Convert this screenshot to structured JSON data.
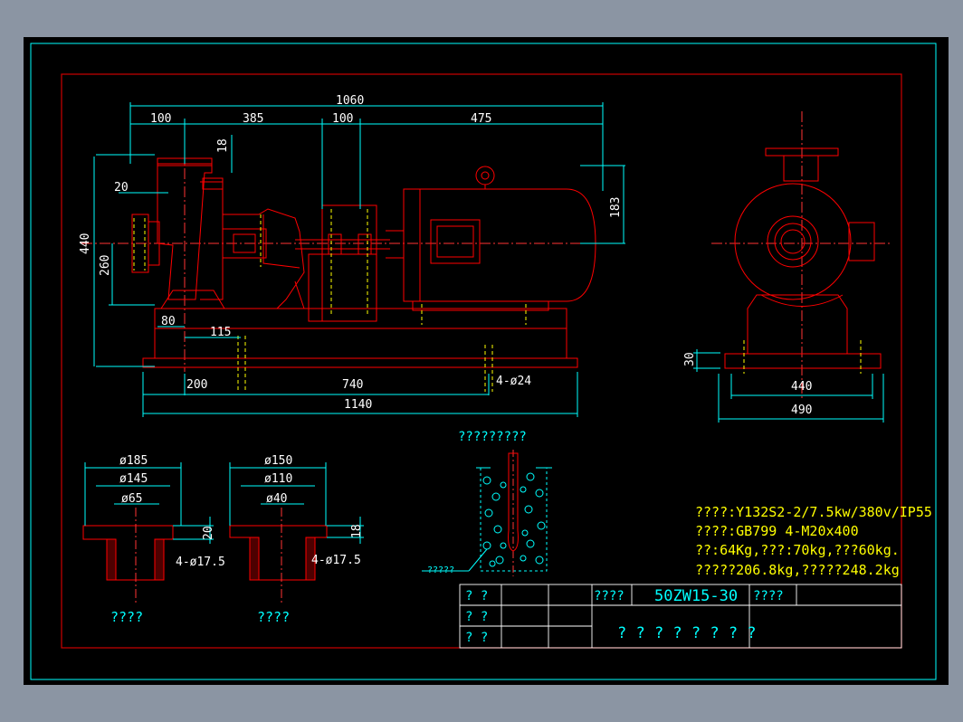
{
  "drawing": {
    "dims_front": {
      "d1060": "1060",
      "d100a": "100",
      "d385": "385",
      "d100b": "100",
      "d475": "475",
      "d18": "18",
      "d20": "20",
      "d440": "440",
      "d260": "260",
      "d183": "183",
      "d80": "80",
      "d115": "115",
      "d200": "200",
      "d740": "740",
      "d4hole": "4-ø24",
      "d1140": "1140"
    },
    "dims_side": {
      "d30": "30",
      "d440": "440",
      "d490": "490"
    },
    "flange_in": {
      "d185": "ø185",
      "d145": "ø145",
      "d65": "ø65",
      "d20": "20",
      "holes": "4-ø17.5",
      "caption": "????"
    },
    "flange_out": {
      "d150": "ø150",
      "d110": "ø110",
      "d40": "ø40",
      "d18": "18",
      "holes": "4-ø17.5",
      "caption": "????"
    },
    "anchor": {
      "title": "?????????",
      "label": "?????"
    },
    "notes": [
      "????:Y132S2-2/7.5kw/380v/IP55",
      "????:GB799  4-M20x400",
      "??:64Kg,???:70kg,???60kg.",
      "?????206.8kg,?????248.2kg"
    ],
    "title_block": {
      "r1c1": "? ?",
      "r2c1": "? ?",
      "r3c1": "? ?",
      "label_a": "????",
      "model": "50ZW15-30",
      "label_b": "????",
      "name": "? ? ? ? ? ? ? ?"
    },
    "colors": {
      "frame": "#cc0000",
      "outline": "#ff0000",
      "dim": "#00ffff",
      "text": "#ffffff",
      "note": "#ffff00",
      "hidden": "#ffff00",
      "center": "#ff3333",
      "green": "#00ff00"
    }
  }
}
